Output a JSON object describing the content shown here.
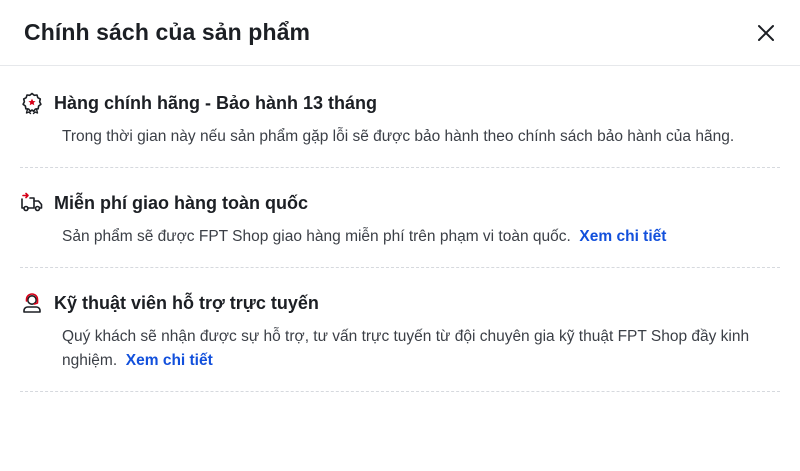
{
  "modal": {
    "title": "Chính sách của sản phẩm",
    "close_icon": "close-icon"
  },
  "policies": [
    {
      "icon": "warranty-badge-icon",
      "title": "Hàng chính hãng - Bảo hành 13 tháng",
      "description": "Trong thời gian này nếu sản phẩm gặp lỗi sẽ được bảo hành theo chính sách bảo hành của hãng.",
      "link": ""
    },
    {
      "icon": "delivery-truck-icon",
      "title": "Miễn phí giao hàng toàn quốc",
      "description": "Sản phẩm sẽ được FPT Shop giao hàng miễn phí trên phạm vi toàn quốc.",
      "link": "Xem chi tiết"
    },
    {
      "icon": "support-agent-icon",
      "title": "Kỹ thuật viên hỗ trợ trực tuyến",
      "description": "Quý khách sẽ nhận được sự hỗ trợ, tư vấn trực tuyến từ đội chuyên gia kỹ thuật FPT Shop đầy kinh nghiệm.",
      "link": "Xem chi tiết"
    }
  ],
  "colors": {
    "accent_red": "#d70018",
    "link_blue": "#1250dc",
    "text": "#1c1f24"
  }
}
